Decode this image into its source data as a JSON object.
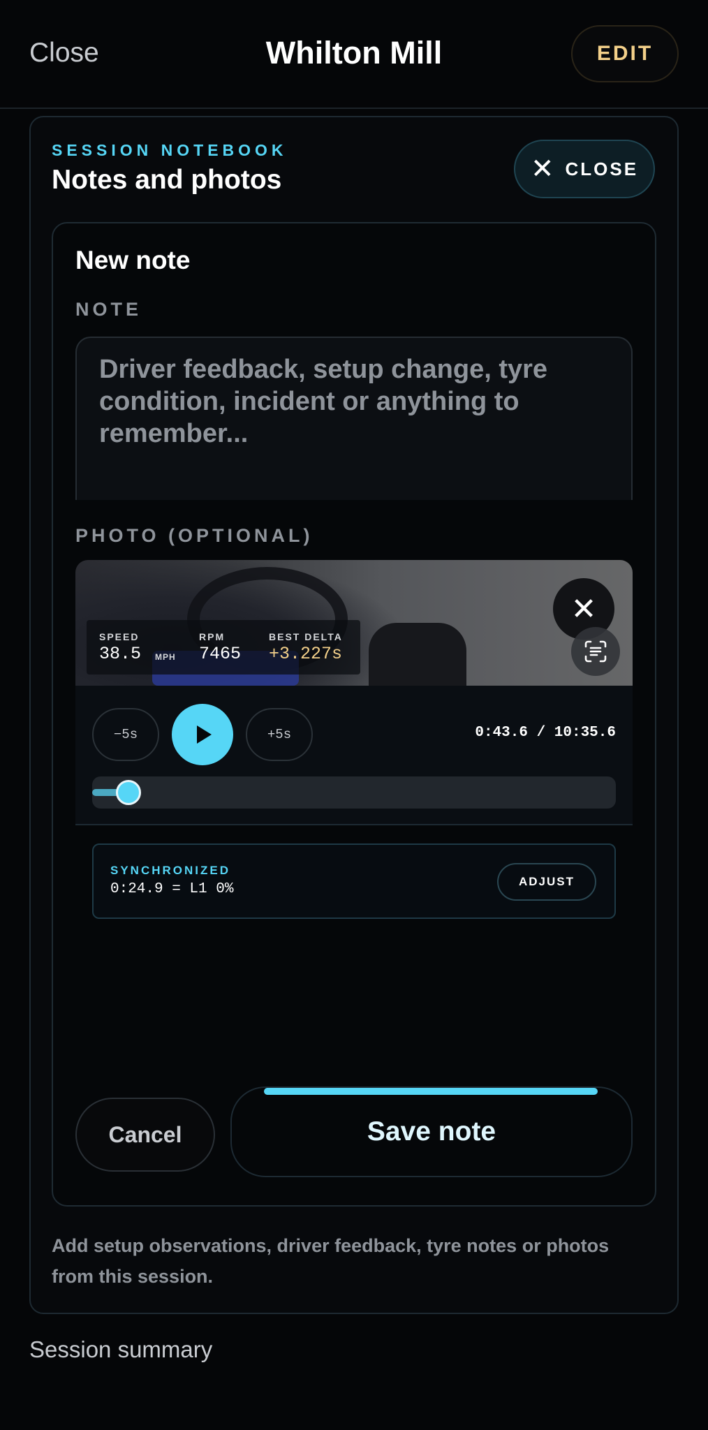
{
  "header": {
    "close_label": "Close",
    "title": "Whilton Mill",
    "edit_label": "EDIT"
  },
  "panel": {
    "eyebrow": "SESSION NOTEBOOK",
    "title": "Notes and photos",
    "close_label": "CLOSE",
    "helper_text": "Add setup observations, driver feedback, tyre notes or photos from this session."
  },
  "card": {
    "title": "New note",
    "note_label": "NOTE",
    "note_placeholder": "Driver feedback, setup change, tyre condition, incident or anything to remember...",
    "photo_label": "PHOTO (OPTIONAL)"
  },
  "video": {
    "overlay": {
      "speed_label": "SPEED",
      "speed_value": "38.5",
      "speed_unit": "MPH",
      "rpm_label": "RPM",
      "rpm_value": "7465",
      "delta_label": "BEST DELTA",
      "delta_value": "+3.227s"
    },
    "back_label": "−5s",
    "forward_label": "+5s",
    "timecode": "0:43.6 / 10:35.6",
    "progress_fraction": 0.069
  },
  "sync": {
    "label": "SYNCHRONIZED",
    "value": "0:24.9 = L1 0%",
    "adjust_label": "ADJUST"
  },
  "actions": {
    "cancel_label": "Cancel",
    "save_label": "Save note"
  },
  "footer": {
    "section_label": "Session summary"
  },
  "colors": {
    "accent": "#56d6f6",
    "gold": "#f3d08a",
    "muted": "#8f949b",
    "background": "#050608"
  }
}
